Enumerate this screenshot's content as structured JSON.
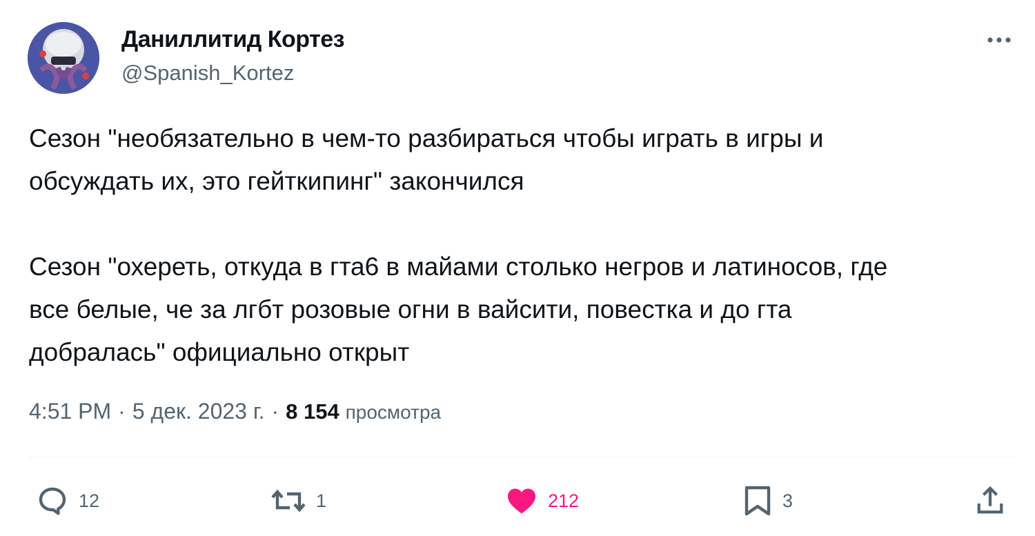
{
  "author": {
    "display_name": "Даниллитид Кортез",
    "handle": "@Spanish_Kortez"
  },
  "tweet": {
    "text": "Сезон \"необязательно в чем-то разбираться чтобы играть в игры и\nобсуждать их, это гейткипинг\" закончился\n\nСезон \"охереть, откуда в гта6 в майами столько негров и латиносов, где\nвсе белые, че за лгбт розовые огни в вайсити, повестка и до гта\nдобралась\" официально открыт"
  },
  "meta": {
    "time": "4:51 PM",
    "separator": "·",
    "date": "5 дек. 2023 г.",
    "views_count": "8 154",
    "views_label": "просмотра"
  },
  "actions": {
    "reply": {
      "icon": "reply-icon",
      "count": "12"
    },
    "repost": {
      "icon": "repost-icon",
      "count": "1"
    },
    "like": {
      "icon": "heart-icon",
      "count": "212",
      "liked": true
    },
    "bookmark": {
      "icon": "bookmark-icon",
      "count": "3"
    },
    "share": {
      "icon": "share-icon"
    }
  },
  "colors": {
    "text_primary": "#0f1419",
    "text_secondary": "#536471",
    "like_active": "#f91880",
    "divider": "#eff3f4"
  }
}
